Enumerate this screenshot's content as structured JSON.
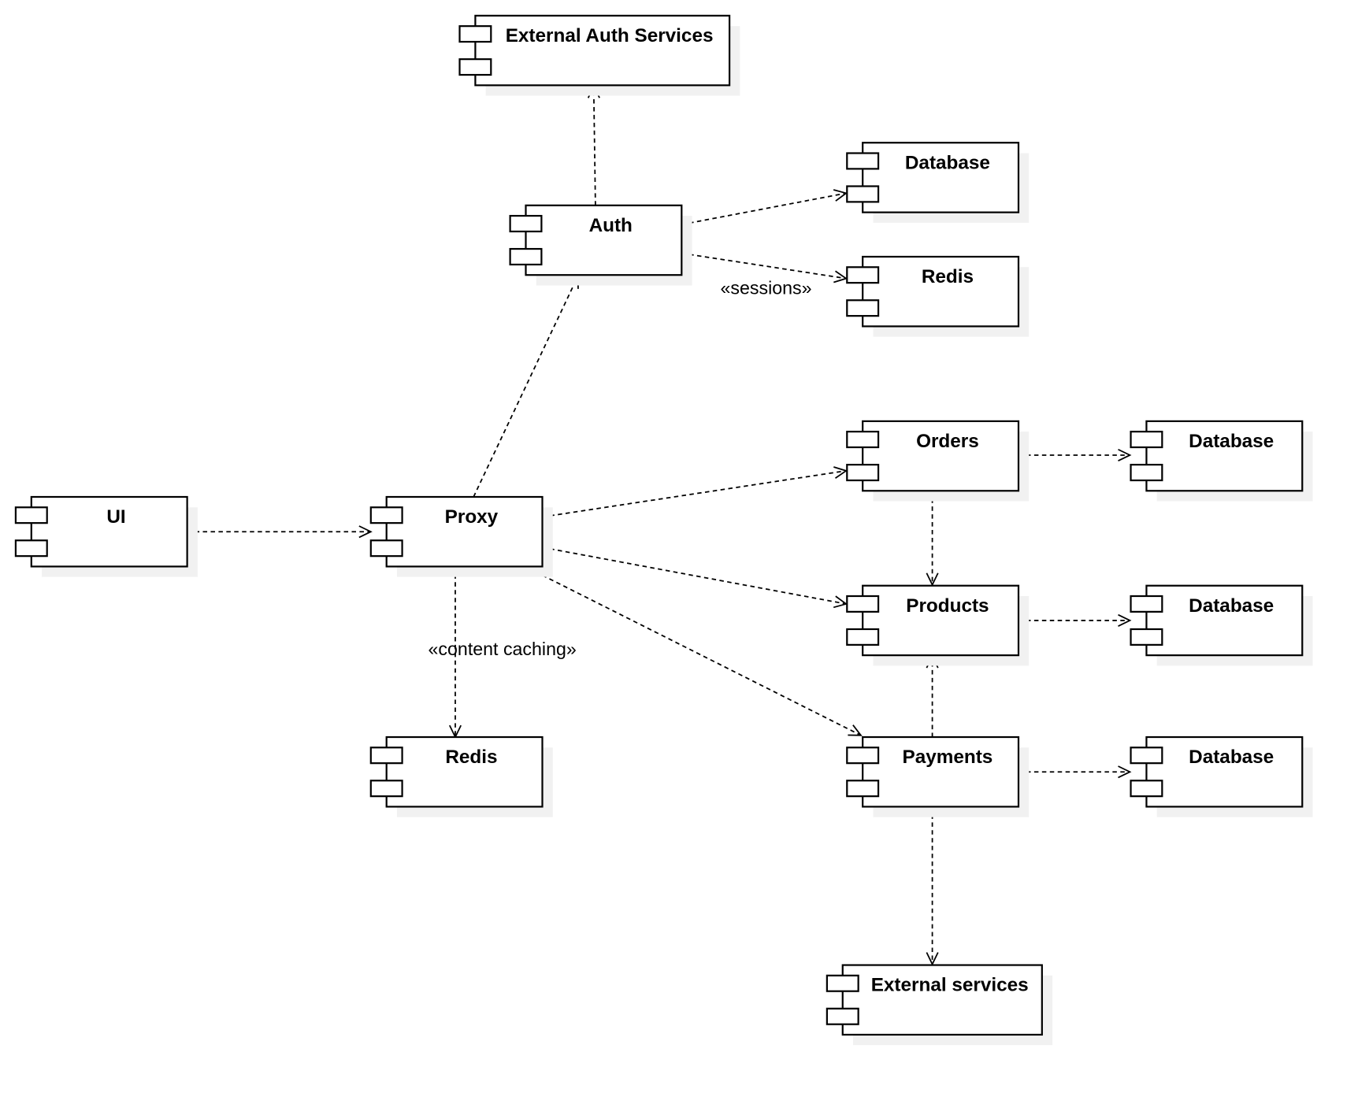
{
  "components": [
    {
      "id": "ext_auth",
      "label": "External Auth Services"
    },
    {
      "id": "db_auth",
      "label": "Database"
    },
    {
      "id": "redis_auth",
      "label": "Redis"
    },
    {
      "id": "auth",
      "label": "Auth"
    },
    {
      "id": "orders",
      "label": "Orders"
    },
    {
      "id": "db_orders",
      "label": "Database"
    },
    {
      "id": "ui",
      "label": "UI"
    },
    {
      "id": "proxy",
      "label": "Proxy"
    },
    {
      "id": "products",
      "label": "Products"
    },
    {
      "id": "db_products",
      "label": "Database"
    },
    {
      "id": "redis_proxy",
      "label": "Redis"
    },
    {
      "id": "payments",
      "label": "Payments"
    },
    {
      "id": "db_payments",
      "label": "Database"
    },
    {
      "id": "ext_services",
      "label": "External services"
    }
  ],
  "dependencies": [
    {
      "from": "auth",
      "to": "ext_auth",
      "label": ""
    },
    {
      "from": "auth",
      "to": "db_auth",
      "label": ""
    },
    {
      "from": "auth",
      "to": "redis_auth",
      "label": "«sessions»"
    },
    {
      "from": "proxy",
      "to": "auth",
      "label": ""
    },
    {
      "from": "ui",
      "to": "proxy",
      "label": ""
    },
    {
      "from": "proxy",
      "to": "orders",
      "label": ""
    },
    {
      "from": "proxy",
      "to": "products",
      "label": ""
    },
    {
      "from": "proxy",
      "to": "payments",
      "label": ""
    },
    {
      "from": "proxy",
      "to": "redis_proxy",
      "label": "«content caching»"
    },
    {
      "from": "orders",
      "to": "db_orders",
      "label": ""
    },
    {
      "from": "orders",
      "to": "products",
      "label": ""
    },
    {
      "from": "products",
      "to": "db_products",
      "label": ""
    },
    {
      "from": "payments",
      "to": "products",
      "label": ""
    },
    {
      "from": "payments",
      "to": "db_payments",
      "label": ""
    },
    {
      "from": "payments",
      "to": "ext_services",
      "label": ""
    }
  ]
}
